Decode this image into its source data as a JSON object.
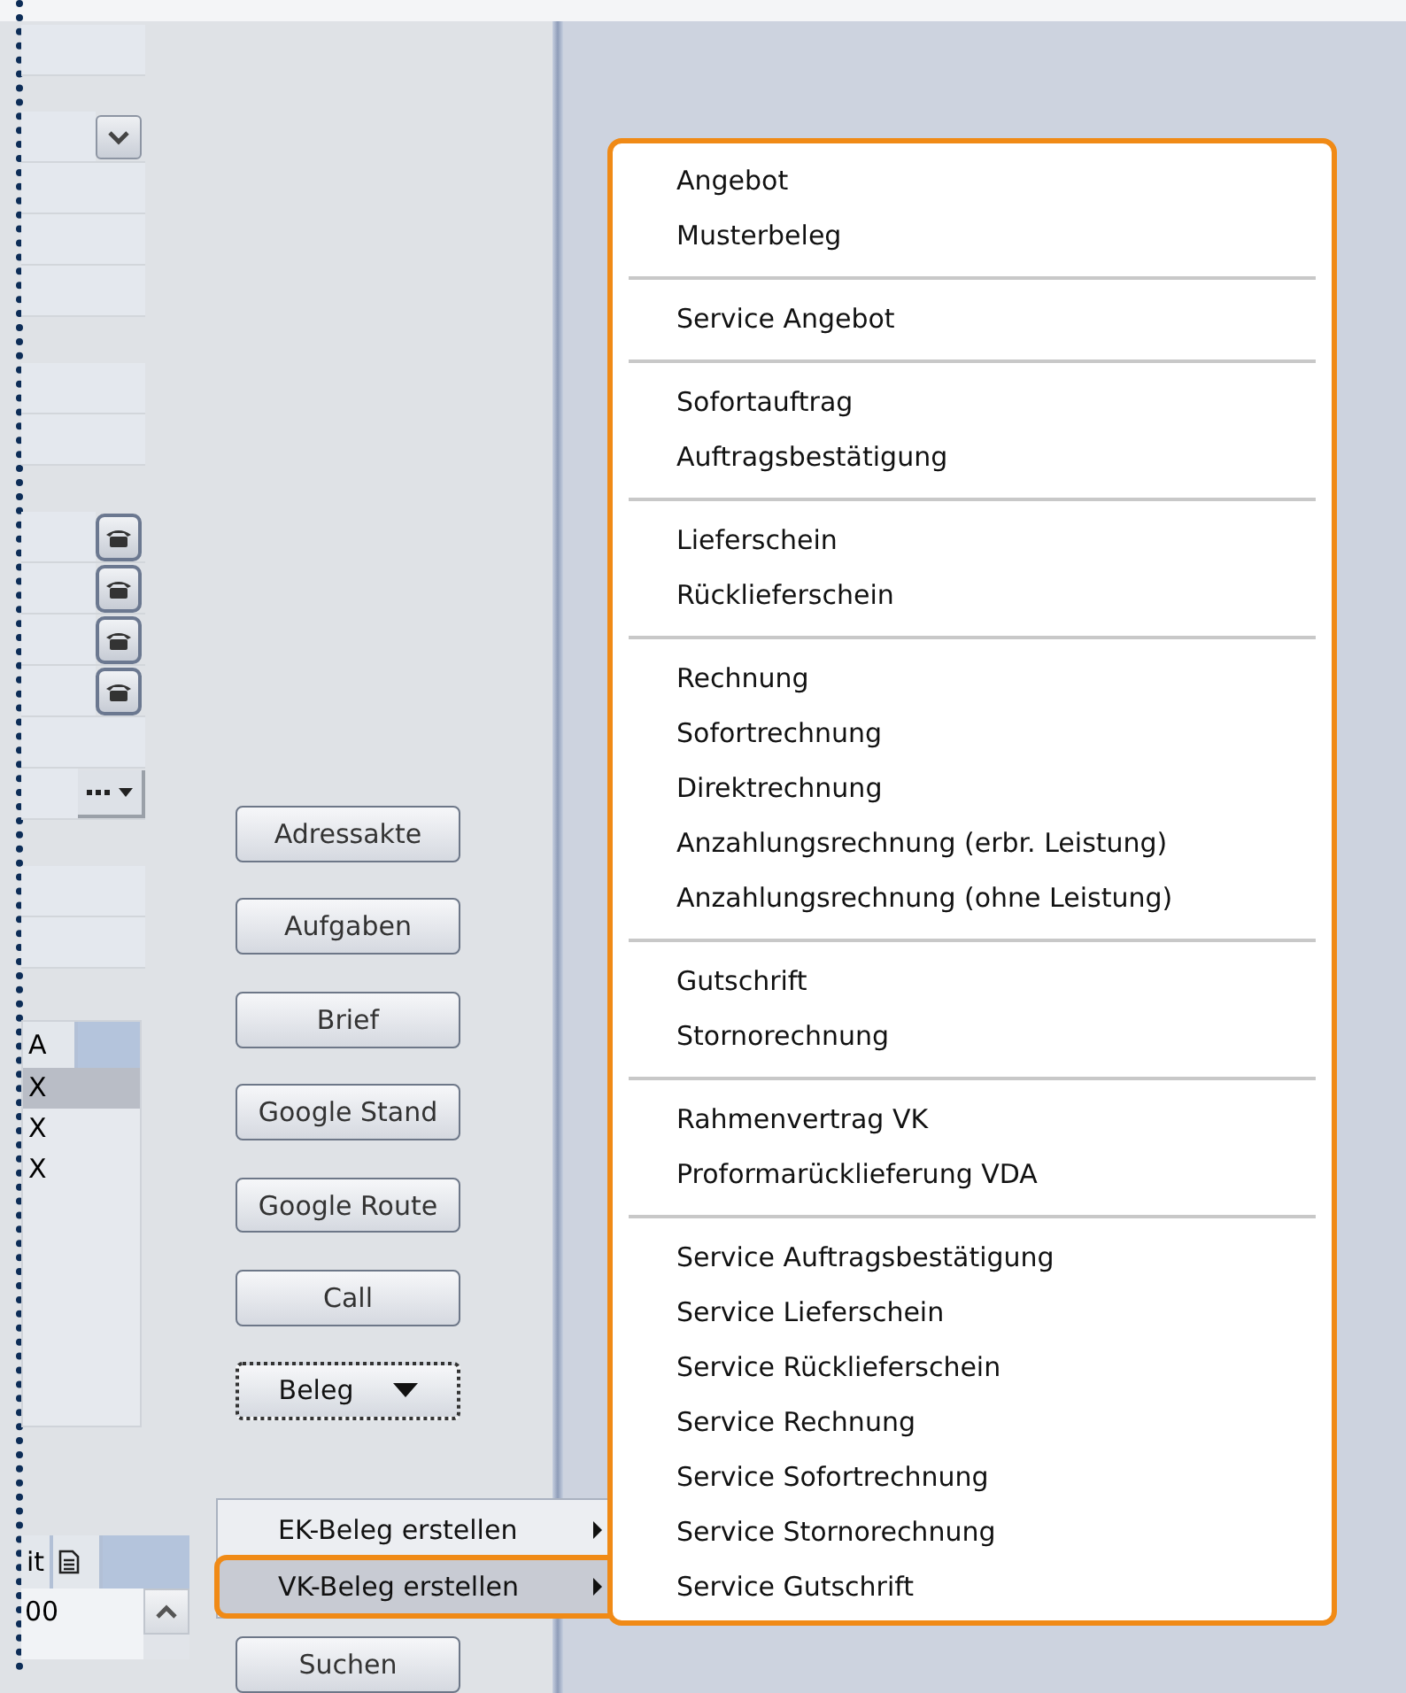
{
  "form": {
    "field_groups": [
      {
        "fields": [
          {
            "kind": "text"
          }
        ]
      },
      {
        "fields": [
          {
            "kind": "dropdown"
          },
          {
            "kind": "text"
          },
          {
            "kind": "text"
          },
          {
            "kind": "text"
          }
        ]
      },
      {
        "fields": [
          {
            "kind": "text"
          },
          {
            "kind": "text"
          }
        ]
      },
      {
        "fields": [
          {
            "kind": "phone"
          },
          {
            "kind": "phone"
          },
          {
            "kind": "phone"
          },
          {
            "kind": "phone"
          },
          {
            "kind": "text"
          },
          {
            "kind": "picker"
          }
        ]
      },
      {
        "fields": [
          {
            "kind": "text"
          },
          {
            "kind": "text"
          }
        ]
      }
    ]
  },
  "list_table": {
    "columns": [
      "A"
    ],
    "rows": [
      {
        "cells": [
          "X"
        ],
        "selected": true
      },
      {
        "cells": [
          "X"
        ],
        "selected": false
      },
      {
        "cells": [
          "X"
        ],
        "selected": false
      }
    ]
  },
  "bottom_table": {
    "columns": [
      {
        "kind": "text",
        "label": "it"
      },
      {
        "kind": "icon"
      },
      {
        "kind": "blank"
      }
    ],
    "rows": [
      {
        "cells": [
          "00"
        ]
      }
    ]
  },
  "buttons": [
    {
      "label": "Adressakte",
      "kind": "plain",
      "focused": false
    },
    {
      "label": "Aufgaben",
      "kind": "plain",
      "focused": false
    },
    {
      "label": "Brief",
      "kind": "plain",
      "focused": false
    },
    {
      "label": "Google Stand",
      "kind": "plain",
      "focused": false
    },
    {
      "label": "Google Route",
      "kind": "plain",
      "focused": false
    },
    {
      "label": "Call",
      "kind": "plain",
      "focused": false
    },
    {
      "label": "Beleg",
      "kind": "dropdown",
      "focused": true
    },
    {
      "label": "Suchen",
      "kind": "plain",
      "focused": false
    }
  ],
  "beleg_menu": {
    "items": [
      {
        "label": "EK-Beleg erstellen",
        "selected": false,
        "has_submenu": true
      },
      {
        "label": "VK-Beleg erstellen",
        "selected": true,
        "has_submenu": true
      }
    ]
  },
  "vk_menu": {
    "groups": [
      {
        "items": [
          "Angebot",
          "Musterbeleg"
        ]
      },
      {
        "items": [
          "Service Angebot"
        ]
      },
      {
        "items": [
          "Sofortauftrag",
          "Auftragsbestätigung"
        ]
      },
      {
        "items": [
          "Lieferschein",
          "Rücklieferschein"
        ]
      },
      {
        "items": [
          "Rechnung",
          "Sofortrechnung",
          "Direktrechnung",
          "Anzahlungsrechnung (erbr. Leistung)",
          "Anzahlungsrechnung (ohne Leistung)"
        ]
      },
      {
        "items": [
          "Gutschrift",
          "Stornorechnung"
        ]
      },
      {
        "items": [
          "Rahmenvertrag VK",
          "Proformarücklieferung VDA"
        ]
      },
      {
        "items": [
          "Service Auftragsbestätigung",
          "Service Lieferschein",
          "Service Rücklieferschein",
          "Service Rechnung",
          "Service Sofortrechnung",
          "Service Stornorechnung",
          "Service Gutschrift"
        ]
      }
    ]
  }
}
